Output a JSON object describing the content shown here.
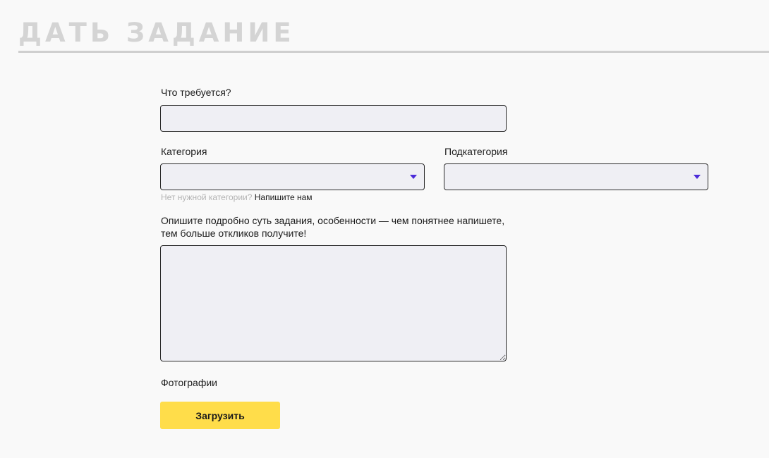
{
  "header": {
    "title": "ДАТЬ ЗАДАНИЕ"
  },
  "form": {
    "what_label": "Что требуется?",
    "what_value": "",
    "category_label": "Категория",
    "category_value": "",
    "subcategory_label": "Подкатегория",
    "subcategory_value": "",
    "hint_text": "Нет нужной категории?",
    "hint_link": "Напишите нам",
    "description_label_line1": "Опишите подробно суть задания, особенности — чем понятнее напишете,",
    "description_label_line2": "тем больше откликов получите!",
    "description_value": "",
    "photos_label": "Фотографии",
    "upload_button": "Загрузить"
  },
  "colors": {
    "accent_yellow": "#ffdd4a",
    "caret_purple": "#4b2bd9",
    "field_background": "#efeff4",
    "title_gray": "#d4d4d4"
  },
  "icons": {
    "dropdown": "caret-down-icon"
  }
}
